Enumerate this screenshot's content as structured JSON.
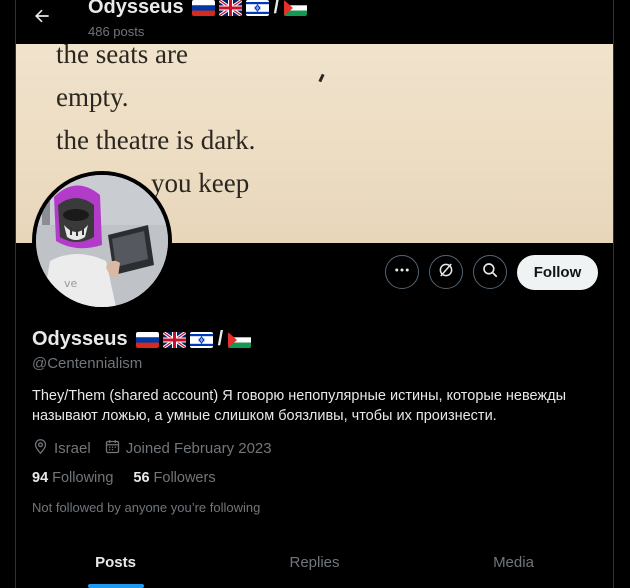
{
  "header": {
    "name": "Odysseus",
    "flag_separator": "/",
    "posts": "486 posts"
  },
  "banner": {
    "lines": [
      "the seats are",
      "empty.",
      "the theatre is dark.",
      "you keep"
    ]
  },
  "profile": {
    "name": "Odysseus",
    "flag_separator": "/",
    "handle": "@Centennialism",
    "bio": "They/Them (shared account) Я говорю непопулярные истины, которые невежды называют ложью, а умные слишком боязливы, чтобы их произнести.",
    "location": "Israel",
    "joined": "Joined February 2023",
    "following_count": "94",
    "following_label": "Following",
    "followers_count": "56",
    "followers_label": "Followers",
    "not_followed": "Not followed by anyone you’re following",
    "flags": [
      "russia-flag",
      "uk-flag",
      "israel-flag",
      "palestine-flag"
    ]
  },
  "actions": {
    "follow_label": "Follow",
    "icons": [
      "more-icon",
      "grok-icon",
      "search-icon"
    ]
  },
  "tabs": [
    {
      "label": "Posts",
      "active": true
    },
    {
      "label": "Replies",
      "active": false
    },
    {
      "label": "Media",
      "active": false
    }
  ],
  "colors": {
    "background": "#000000",
    "text": "#e7e9ea",
    "muted": "#71767b",
    "accent": "#1d9bf0",
    "follow_bg": "#eff3f4"
  }
}
